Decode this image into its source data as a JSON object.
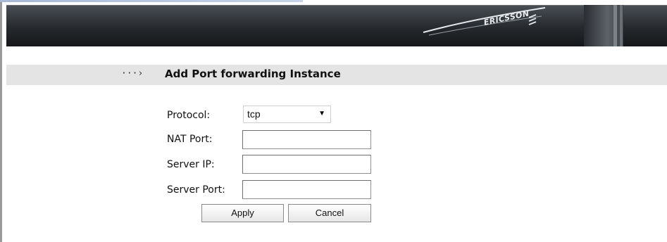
{
  "header": {
    "brand": "ERICSSON"
  },
  "section": {
    "title": "Add Port forwarding Instance",
    "arrow_glyph": "···›"
  },
  "form": {
    "protocol_label": "Protocol:",
    "protocol_value": "tcp",
    "nat_port_label": "NAT Port:",
    "nat_port_value": "",
    "server_ip_label": "Server IP:",
    "server_ip_value": "",
    "server_port_label": "Server Port:",
    "server_port_value": "",
    "apply_label": "Apply",
    "cancel_label": "Cancel"
  },
  "colors": {
    "header_dark": "#26292d",
    "band": "#e4e4e4"
  },
  "icons": {
    "arrow": "dotted-arrow-icon",
    "caret": "chevron-down-icon",
    "brand": "ericsson-logo-icon"
  }
}
